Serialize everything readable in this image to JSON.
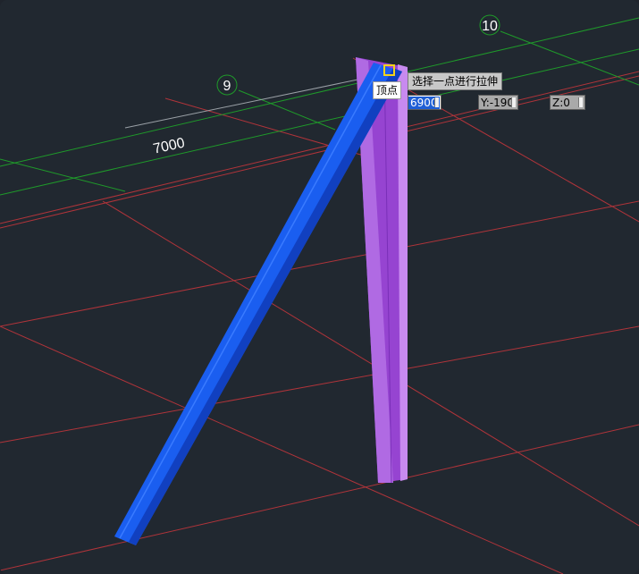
{
  "grid_labels": [
    "9",
    "10"
  ],
  "dimension_label": "7000",
  "snap_tooltip": "顶点",
  "prompt_tooltip": "选择一点进行拉伸",
  "dynamic_input": {
    "x": "6900",
    "y": "Y:-190",
    "z": "Z:0"
  },
  "colors": {
    "background": "#212830",
    "grid_red": "#b8323a",
    "axis_green": "#1f9a2a",
    "beam_blue": "#1a5ef0",
    "column_purple": "#a346d9",
    "snap_marker": "#f2d21b"
  }
}
